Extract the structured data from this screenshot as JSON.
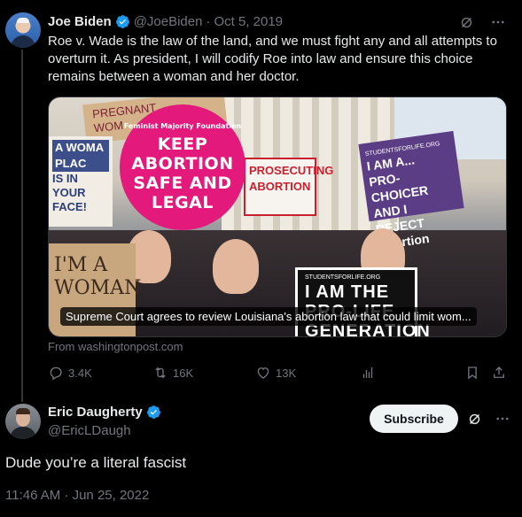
{
  "original_tweet": {
    "name": "Joe Biden",
    "handle": "@JoeBiden",
    "separator": "·",
    "date": "Oct 5, 2019",
    "text": "Roe v. Wade is the law of the land, and we must fight any and all attempts to overturn it. As president, I will codify Roe into law and ensure this choice remains between a woman and her doctor.",
    "media": {
      "caption": "Supreme Court agrees to review Louisiana's abortion law that could limit wom...",
      "signs": {
        "pink_arc": "Feminist Majority Foundation",
        "pink_lines": [
          "KEEP",
          "ABORTION",
          "SAFE AND",
          "LEGAL"
        ],
        "purple_lines": [
          "STUDENTSFORLIFE.ORG",
          "I AM A...",
          "PRO-CHOICER",
          "AND I REJECT",
          "Abortion"
        ],
        "red_lines": [
          "PROSECUTING",
          "ABORTION"
        ],
        "left_lines": [
          "A WOMA",
          "PLAC",
          "IS IN YOUR",
          "FACE!"
        ],
        "cardboard_lines": [
          "I'M A",
          "WOMAN"
        ],
        "cardboard_top_lines": [
          "PREGNANT",
          "WOM"
        ],
        "prolife_org": "STUDENTSFORLIFE.ORG",
        "prolife_lines": [
          "I AM THE",
          "PRO-LIFE",
          "GENERATION"
        ]
      }
    },
    "source": "From washingtonpost.com",
    "stats": {
      "replies": "3.4K",
      "reposts": "16K",
      "likes": "13K"
    }
  },
  "reply": {
    "name": "Eric Daugherty",
    "handle": "@EricLDaugh",
    "subscribe_label": "Subscribe",
    "text": "Dude you’re a literal fascist",
    "timestamp": "11:46 AM · Jun 25, 2022"
  },
  "icons": {
    "verified": "verified-badge-icon",
    "grok": "grok-icon",
    "more": "more-icon",
    "reply": "reply-icon",
    "repost": "repost-icon",
    "like": "heart-icon",
    "views": "views-icon",
    "bookmark": "bookmark-icon",
    "share": "share-icon"
  },
  "colors": {
    "background": "#000000",
    "text": "#e7e9ea",
    "muted": "#71767b",
    "verified": "#1d9bf0",
    "thread_line": "#333639"
  }
}
